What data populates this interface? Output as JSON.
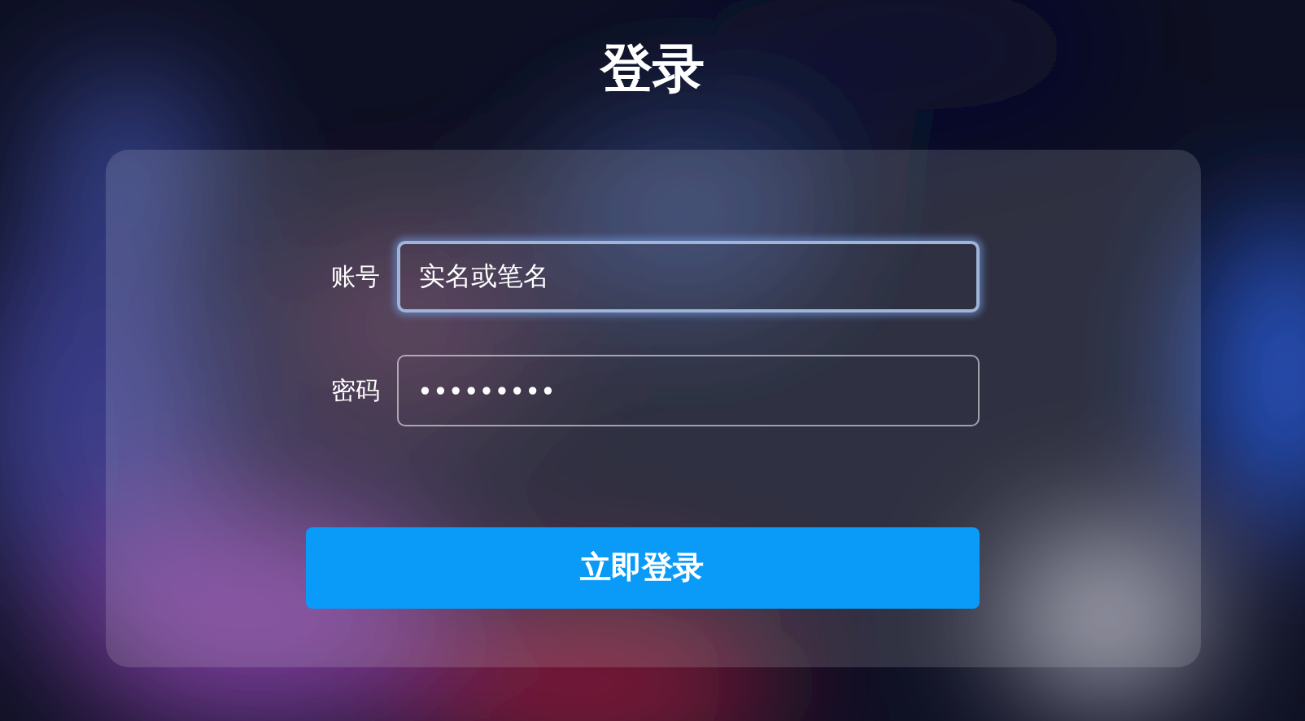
{
  "title": "登录",
  "fields": [
    {
      "label": "账号",
      "value": "实名或笔名",
      "focused": true
    },
    {
      "label": "密码",
      "value": "•••••••••",
      "focused": false
    }
  ],
  "submit": "立即登录"
}
